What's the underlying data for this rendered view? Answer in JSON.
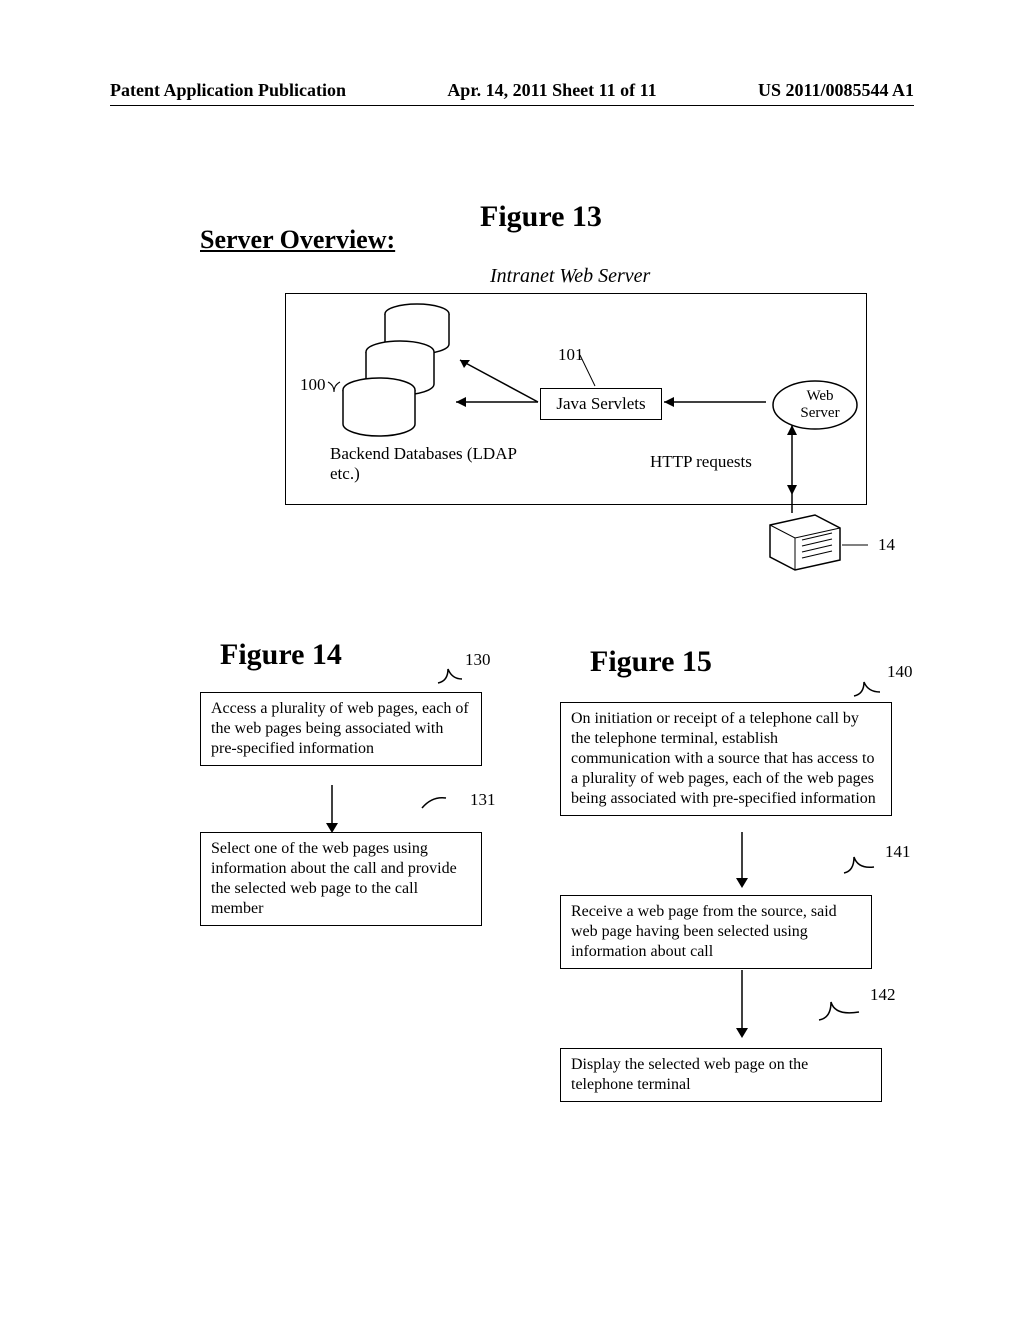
{
  "header": {
    "left": "Patent Application Publication",
    "mid": "Apr. 14, 2011  Sheet 11 of 11",
    "right": "US 2011/0085544 A1"
  },
  "fig13": {
    "section_title": "Server Overview:",
    "title": "Figure 13",
    "subtitle": "Intranet Web Server",
    "backend_label": "Backend Databases (LDAP etc.)",
    "servlets_label": "Java Servlets",
    "webserver_label": "Web Server",
    "http_label": "HTTP requests",
    "num100": "100",
    "num101": "101",
    "num14": "14"
  },
  "fig14": {
    "title": "Figure 14",
    "num130": "130",
    "num131": "131",
    "box1": "Access a plurality of web pages, each of the web pages being associated with pre-specified information",
    "box2": "Select one of the web pages using information about the call and provide  the selected web page to the call member"
  },
  "fig15": {
    "title": "Figure 15",
    "num140": "140",
    "num141": "141",
    "num142": "142",
    "box1": "On initiation or receipt of a telephone call by the telephone terminal, establish communication with a source that has access to a plurality of web pages, each of the web pages being associated with pre-specified information",
    "box2": "Receive a web page from the source, said web page having been selected using information about call",
    "box3": "Display the selected web page on the telephone terminal"
  }
}
